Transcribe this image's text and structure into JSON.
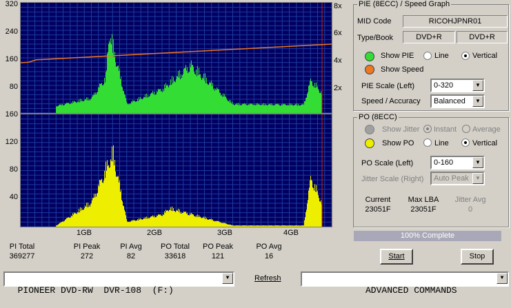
{
  "pie_graph": {
    "y_labels": [
      "320",
      "240",
      "160",
      "80"
    ],
    "right_labels": [
      "8x",
      "6x",
      "4x",
      "2x"
    ]
  },
  "po_graph": {
    "y_labels": [
      "160",
      "120",
      "80",
      "40"
    ],
    "x_labels": [
      "1GB",
      "2GB",
      "3GB",
      "4GB"
    ]
  },
  "stats": [
    {
      "label": "PI Total",
      "value": "369277"
    },
    {
      "label": "PI Peak",
      "value": "272"
    },
    {
      "label": "PI Avg",
      "value": "82"
    },
    {
      "label": "PO Total",
      "value": "33618"
    },
    {
      "label": "PO Peak",
      "value": "121"
    },
    {
      "label": "PO Avg",
      "value": "16"
    }
  ],
  "pie_panel": {
    "title": "PIE (8ECC) / Speed Graph",
    "mid_code_label": "MID Code",
    "mid_code_value": "RICOHJPNR01",
    "type_book_label": "Type/Book",
    "type_value": "DVD+R",
    "book_value": "DVD+R",
    "show_pie_label": "Show PIE",
    "line_label": "Line",
    "vertical_label": "Vertical",
    "show_speed_label": "Show Speed",
    "pie_scale_label": "PIE Scale (Left)",
    "pie_scale_value": "0-320",
    "speed_accuracy_label": "Speed / Accuracy",
    "speed_accuracy_value": "Balanced",
    "pie_color": "#33dd33",
    "speed_color": "#ee7722"
  },
  "po_panel": {
    "title": "PO (8ECC)",
    "show_jitter_label": "Show Jitter",
    "instant_label": "Instant",
    "average_label": "Average",
    "show_po_label": "Show PO",
    "line_label": "Line",
    "vertical_label": "Vertical",
    "po_scale_label": "PO Scale (Left)",
    "po_scale_value": "0-160",
    "jitter_scale_label": "Jitter Scale (Right)",
    "jitter_scale_value": "Auto Peak",
    "current_label": "Current",
    "current_value": "23051F",
    "max_lba_label": "Max LBA",
    "max_lba_value": "23051F",
    "jitter_avg_label": "Jitter Avg",
    "jitter_avg_value": "0",
    "po_color": "#eeee00"
  },
  "progress_text": "100% Complete",
  "buttons": {
    "start": "Start",
    "stop": "Stop"
  },
  "bottom": {
    "drive": "PIONEER DVD-RW  DVR-108  (F:)",
    "refresh": "Refresh",
    "commands": "ADVANCED COMMANDS"
  },
  "chart_data": [
    {
      "type": "bar",
      "title": "",
      "series_name": "PIE",
      "x": [
        0.5,
        1.0,
        1.2,
        1.25,
        1.5,
        2.0,
        2.4,
        3.0,
        4.0,
        4.1,
        4.4
      ],
      "values": [
        24,
        50,
        120,
        272,
        30,
        80,
        160,
        30,
        28,
        110,
        30
      ],
      "ylim": [
        0,
        320
      ],
      "speed_x": [
        0,
        4.4
      ],
      "speed_values": [
        3.8,
        5.0
      ]
    },
    {
      "type": "bar",
      "title": "",
      "series_name": "PO",
      "x": [
        0.5,
        1.0,
        1.15,
        1.3,
        1.5,
        2.0,
        2.1,
        3.0,
        4.0,
        4.1,
        4.4
      ],
      "values": [
        2,
        40,
        80,
        121,
        8,
        20,
        30,
        2,
        2,
        80,
        2
      ],
      "ylim": [
        0,
        160
      ]
    }
  ]
}
